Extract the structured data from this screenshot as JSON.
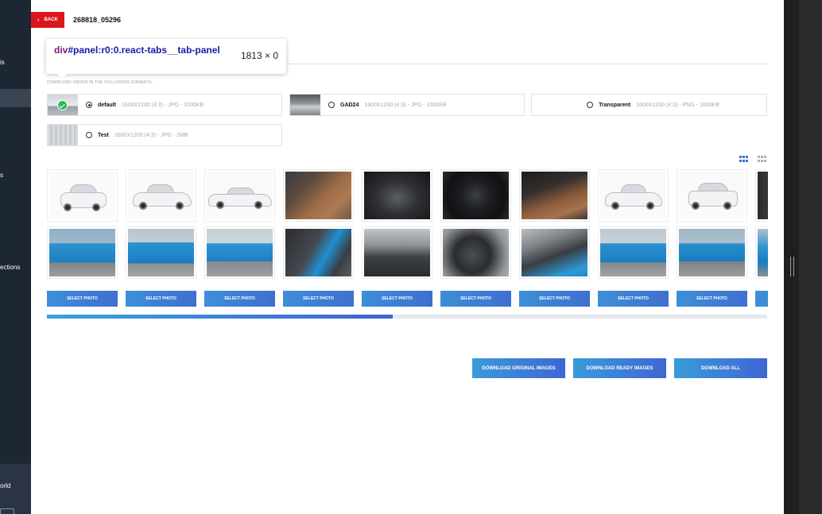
{
  "sidebar": {
    "partial_labels": [
      "is",
      "ections",
      "orld"
    ]
  },
  "header": {
    "back_label": "BACK",
    "order_id": "268818_05296"
  },
  "devtools_tooltip": {
    "tag": "div",
    "selector": "#panel:r0:0.react-tabs__tab-panel",
    "size": "1813 × 0"
  },
  "formats": {
    "section_label": "DOWNLOAD ORDER IN THE FOLLOWING FORMATS:",
    "items": [
      {
        "name": "default",
        "spec": "1600X1200 (4:3) - JPG - 1000KB",
        "selected": true
      },
      {
        "name": "GAD24",
        "spec": "1600X1200 (4:3) - JPG - 1000KB",
        "selected": false
      },
      {
        "name": "Transparent",
        "spec": "1600X1200 (4:3) - PNG - 1000KB",
        "selected": false
      },
      {
        "name": "Test",
        "spec": "1600X1200 (4:3) - JPG - 2MB",
        "selected": false
      }
    ]
  },
  "view_toggle": {
    "active": "large-grid",
    "options": [
      "large-grid",
      "small-grid"
    ]
  },
  "gallery": {
    "select_label": "SELECT PHOTO",
    "columns": [
      {
        "top": "white car front",
        "bottom": "blue SUV front"
      },
      {
        "top": "white car front three-quarter",
        "bottom": "blue SUV front three-quarter"
      },
      {
        "top": "white car side",
        "bottom": "blue SUV side"
      },
      {
        "top": "brown leather interior seats",
        "bottom": "interior seats blue accents"
      },
      {
        "top": "dashboard interior",
        "bottom": "front cabin interior"
      },
      {
        "top": "steering wheel",
        "bottom": "steering wheel dashboard"
      },
      {
        "top": "rear seat interior",
        "bottom": "rear seats interior"
      },
      {
        "top": "white car rear three-quarter",
        "bottom": "blue SUV rear three-quarter"
      },
      {
        "top": "white car rear",
        "bottom": "blue SUV rear"
      },
      {
        "top": "partial photo",
        "bottom": "partial photo"
      }
    ]
  },
  "scroll_progress": 0.48,
  "actions": {
    "download_original": "DOWNLOAD ORIGINAL IMAGES",
    "download_ready": "DOWNLOAD READY IMAGES",
    "download_all": "DOWNLOAD ALL"
  },
  "colors": {
    "brand_red": "#d8161c",
    "button_gradient_start": "#3a9bdb",
    "button_gradient_end": "#3f66d2",
    "sidebar_bg": "#1d2633"
  }
}
